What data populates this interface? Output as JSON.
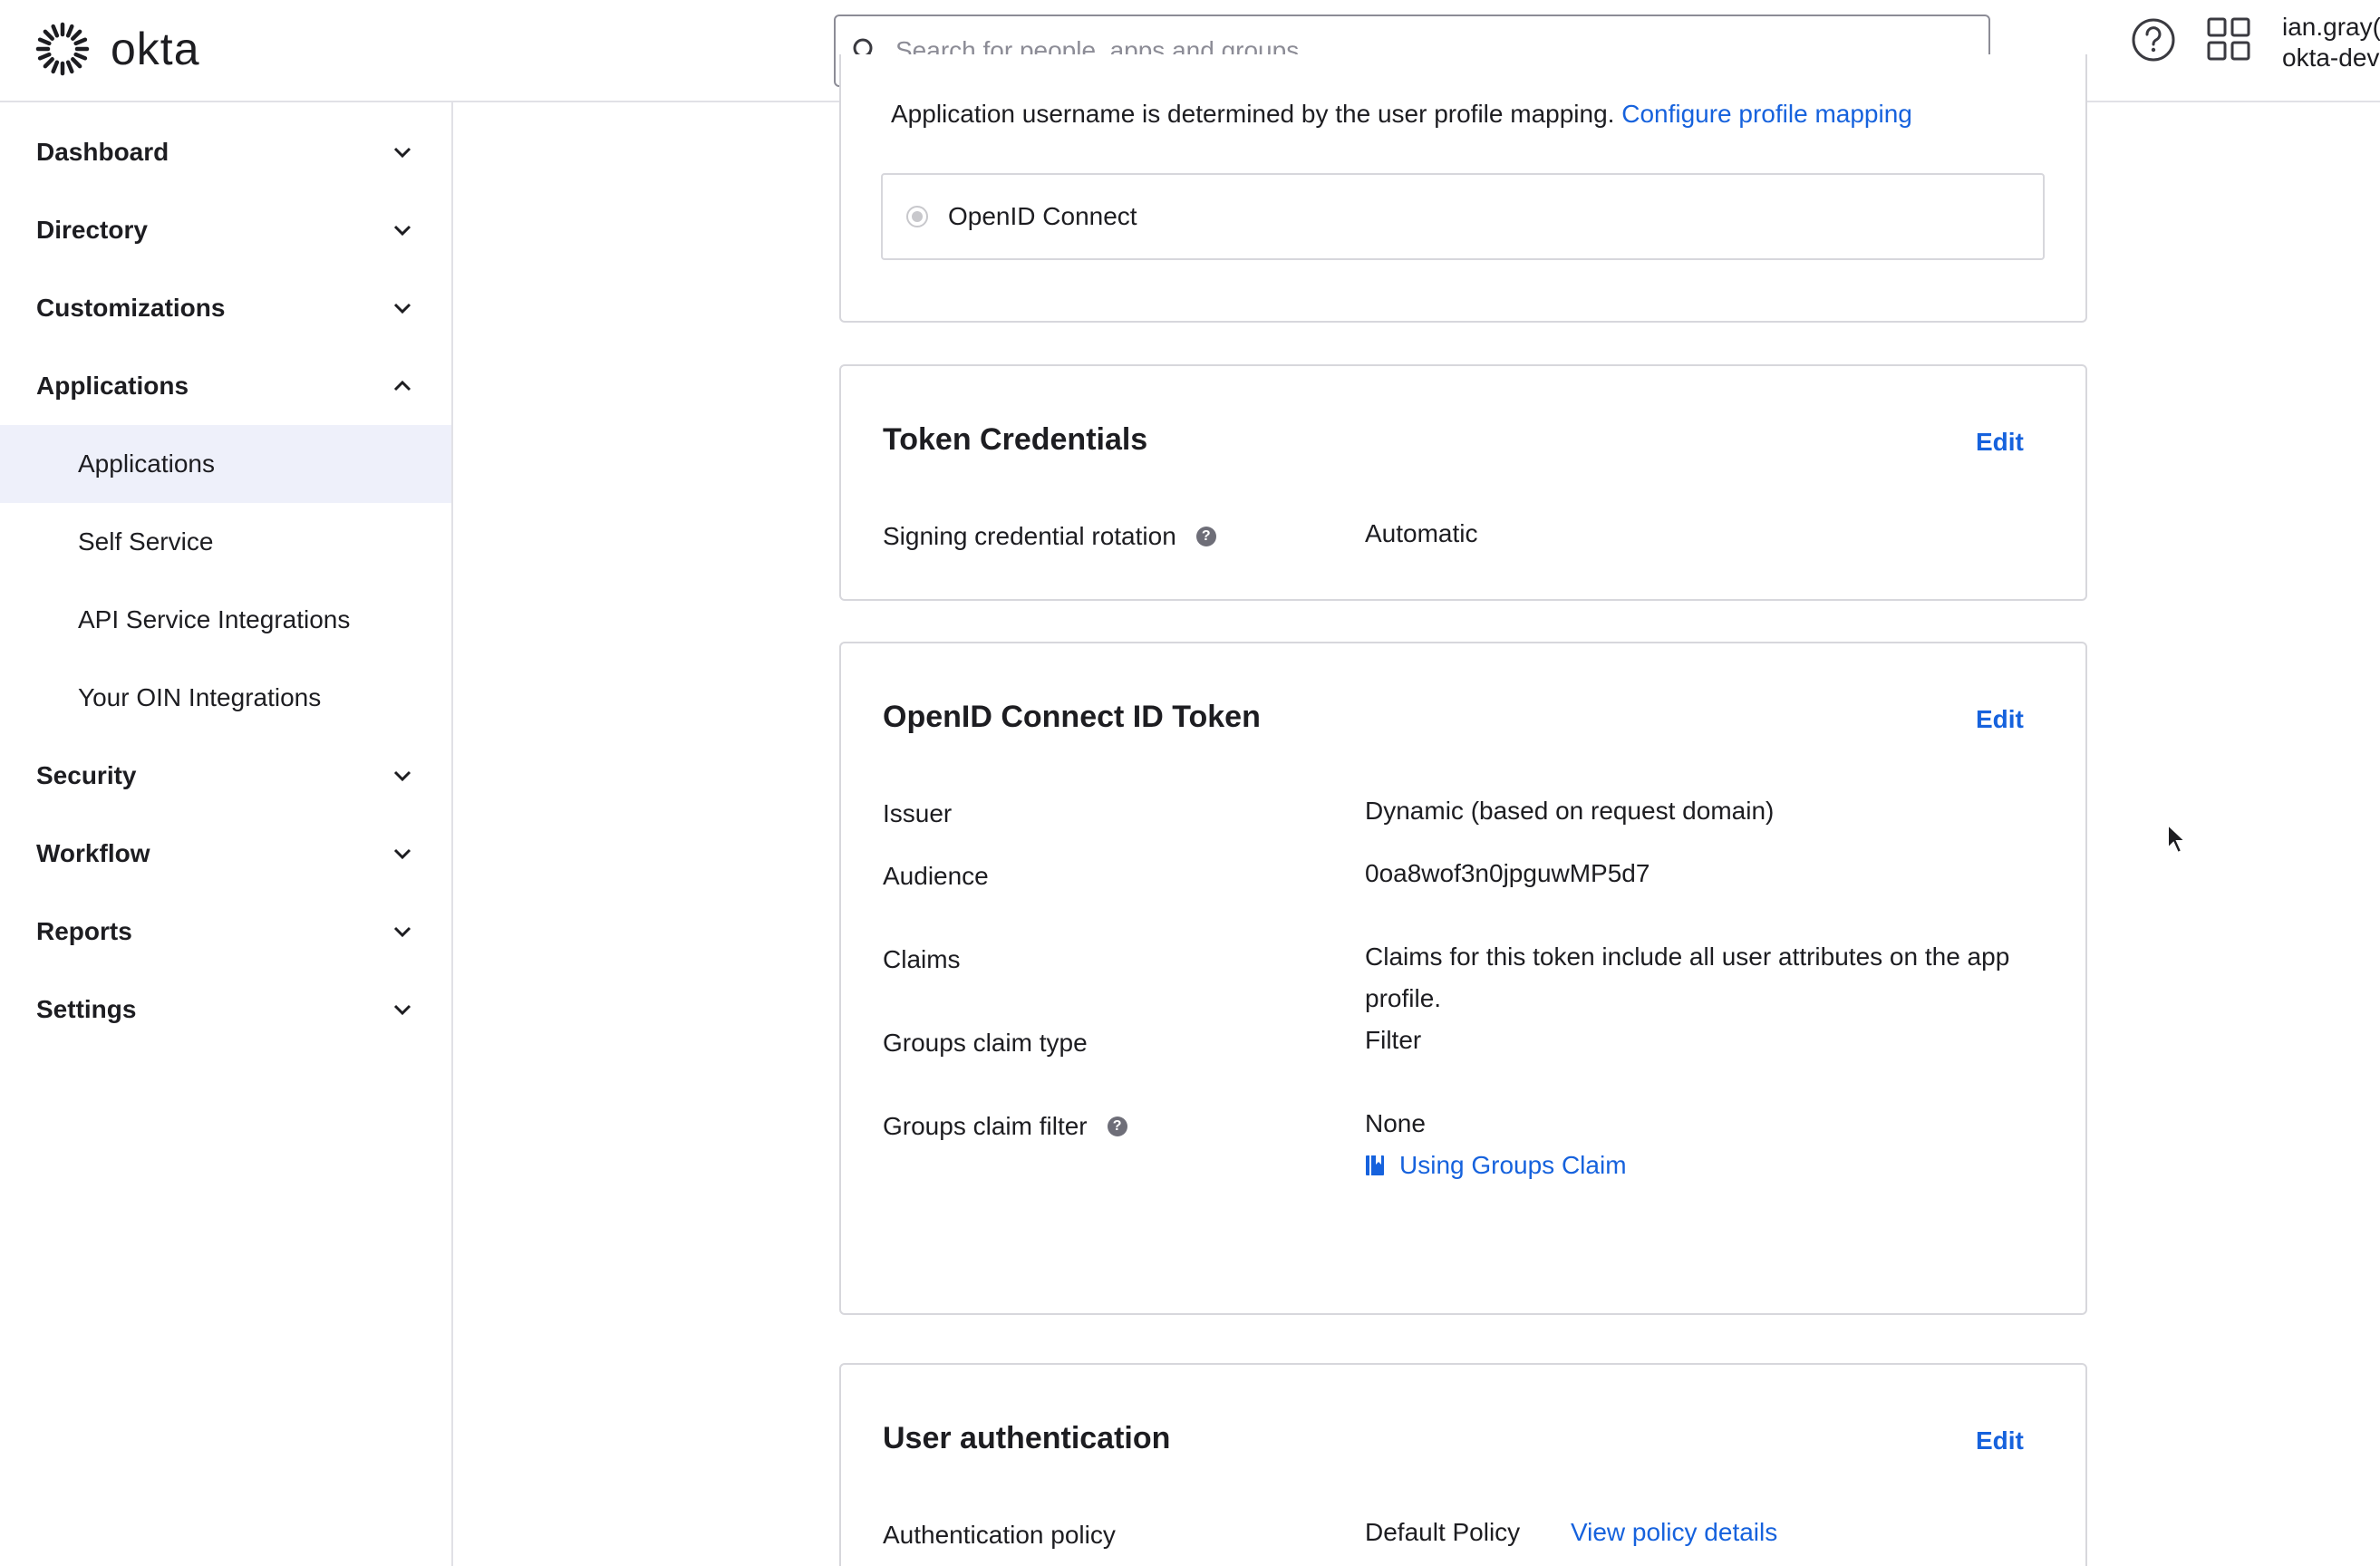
{
  "header": {
    "logo_text": "okta",
    "search_placeholder": "Search for people, apps and groups",
    "user_name": "ian.gray(",
    "user_org": "okta-dev"
  },
  "sidebar": {
    "items": [
      {
        "label": "Dashboard",
        "expanded": false
      },
      {
        "label": "Directory",
        "expanded": false
      },
      {
        "label": "Customizations",
        "expanded": false
      },
      {
        "label": "Applications",
        "expanded": true
      },
      {
        "label": "Security",
        "expanded": false
      },
      {
        "label": "Workflow",
        "expanded": false
      },
      {
        "label": "Reports",
        "expanded": false
      },
      {
        "label": "Settings",
        "expanded": false
      }
    ],
    "sub_items": [
      {
        "label": "Applications",
        "active": true
      },
      {
        "label": "Self Service",
        "active": false
      },
      {
        "label": "API Service Integrations",
        "active": false
      },
      {
        "label": "Your OIN Integrations",
        "active": false
      }
    ]
  },
  "top_card": {
    "username_text": "Application username is determined by the user profile mapping.",
    "configure_link": "Configure profile mapping",
    "radio_label": "OpenID Connect"
  },
  "token_credentials": {
    "title": "Token Credentials",
    "edit_label": "Edit",
    "rotation_label": "Signing credential rotation",
    "rotation_value": "Automatic"
  },
  "oidc_token": {
    "title": "OpenID Connect ID Token",
    "edit_label": "Edit",
    "issuer_label": "Issuer",
    "issuer_value": "Dynamic (based on request domain)",
    "audience_label": "Audience",
    "audience_value": "0oa8wof3n0jpguwMP5d7",
    "claims_label": "Claims",
    "claims_value_line1": "Claims for this token include all user attributes on the app",
    "claims_value_line2": "profile.",
    "groups_claim_type_label": "Groups claim type",
    "groups_claim_type_value": "Filter",
    "groups_claim_filter_label": "Groups claim filter",
    "groups_claim_filter_value": "None",
    "groups_claim_link": "Using Groups Claim"
  },
  "user_auth": {
    "title": "User authentication",
    "edit_label": "Edit",
    "policy_label": "Authentication policy",
    "policy_value": "Default Policy",
    "policy_link": "View policy details"
  },
  "colors": {
    "link": "#1662dd",
    "active_nav_bg": "#eef0fa",
    "border": "#d7d7dc"
  }
}
